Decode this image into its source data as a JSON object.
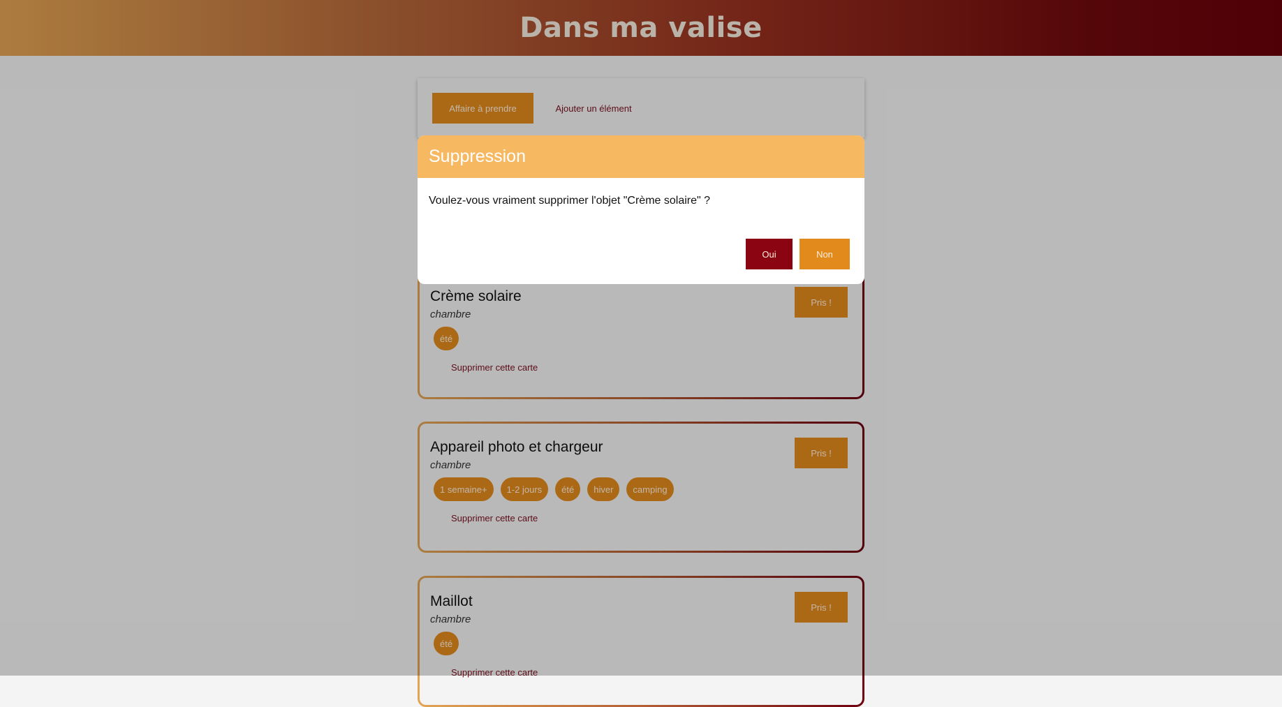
{
  "app": {
    "title": "Dans ma valise"
  },
  "tabs": [
    {
      "label": "Affaire à prendre"
    },
    {
      "label": "Ajouter un élément"
    }
  ],
  "cards": [
    {
      "title": "Crème solaire",
      "location": "chambre",
      "tags": [
        "été"
      ],
      "taken_label": "Pris !",
      "delete_label": "Supprimer cette carte"
    },
    {
      "title": "Appareil photo et chargeur",
      "location": "chambre",
      "tags": [
        "1 semaine+",
        "1-2 jours",
        "été",
        "hiver",
        "camping"
      ],
      "taken_label": "Pris !",
      "delete_label": "Supprimer cette carte"
    },
    {
      "title": "Maillot",
      "location": "chambre",
      "tags": [
        "été"
      ],
      "taken_label": "Pris !",
      "delete_label": "Supprimer cette carte"
    }
  ],
  "modal": {
    "title": "Suppression",
    "message": "Voulez-vous vraiment supprimer l'objet \"Crème solaire\" ?",
    "confirm_label": "Oui",
    "cancel_label": "Non"
  },
  "colors": {
    "accent": "#e38a1c",
    "brand_dark": "#8a0511",
    "link": "#7a1020",
    "modal_header": "#f7b862"
  }
}
